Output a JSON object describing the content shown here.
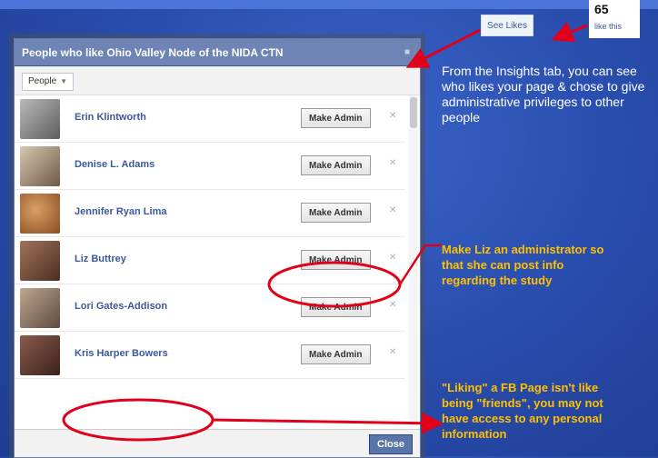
{
  "dialog": {
    "title": "People who like Ohio Valley Node of the NIDA CTN",
    "filter_label": "People",
    "admin_label": "Make Admin",
    "close_label": "Close",
    "people": [
      {
        "name": "Erin Klintworth",
        "avatar_color": "#8a8a8a"
      },
      {
        "name": "Denise L. Adams",
        "avatar_color": "#7b6a58"
      },
      {
        "name": "Jennifer Ryan Lima",
        "avatar_color": "#b5763b"
      },
      {
        "name": "Liz Buttrey",
        "avatar_color": "#6b4a3a"
      },
      {
        "name": "Lori Gates-Addison",
        "avatar_color": "#7d6b5f"
      },
      {
        "name": "Kris Harper Bowers",
        "avatar_color": "#5a3b33"
      }
    ]
  },
  "insights": {
    "see_likes": "See Likes",
    "likes_count": "65",
    "likes_text": "like this"
  },
  "annotations": {
    "description": "From the Insights tab, you can see who likes your page & chose to give administrative privileges to other people",
    "note_admin": "Make Liz an administrator so\nthat she can post info\nregarding the study",
    "note_friends": "\"Liking\" a FB Page isn't like\nbeing \"friends\", you may not\nhave access to any personal\ninformation"
  },
  "colors": {
    "annotation_yellow": "#ffc000",
    "arrow_red": "#e0001a",
    "facebook_blue": "#3b5998"
  }
}
